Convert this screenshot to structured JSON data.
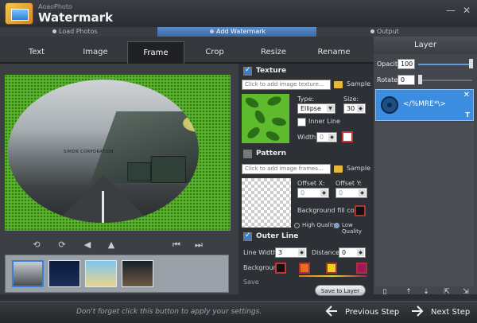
{
  "app": {
    "vendor": "AoaoPhoto",
    "product": "Watermark"
  },
  "steps": [
    {
      "label": "Load Photos",
      "active": false
    },
    {
      "label": "Add Watermark",
      "active": true
    },
    {
      "label": "Output",
      "active": false
    }
  ],
  "tabs": [
    {
      "label": "Text",
      "active": false
    },
    {
      "label": "Image",
      "active": false
    },
    {
      "label": "Frame",
      "active": true
    },
    {
      "label": "Crop",
      "active": false
    },
    {
      "label": "Resize",
      "active": false
    },
    {
      "label": "Rename",
      "active": false
    }
  ],
  "preview": {
    "watermark_text": "SIMDN CORPORATION"
  },
  "texture": {
    "label": "Texture",
    "checked": true,
    "input_placeholder": "Click to add image texture...",
    "sample_label": "Sample",
    "type_label": "Type:",
    "type_value": "Ellipse",
    "size_label": "Size:",
    "size_value": "30",
    "inner_line_label": "Inner Line",
    "width_label": "Width:",
    "width_value": "0"
  },
  "pattern": {
    "label": "Pattern",
    "checked": false,
    "input_placeholder": "Click to add image frames...",
    "sample_label": "Sample",
    "offset_x_label": "Offset X:",
    "offset_x_value": "0",
    "offset_y_label": "Offset Y:",
    "offset_y_value": "0",
    "bg_fill_label": "Background fill color:",
    "quality_high": "High Quality",
    "quality_low": "Low Quality",
    "quality_selected": "Low Quality"
  },
  "outer_line": {
    "label": "Outer Line",
    "checked": true,
    "line_width_label": "Line Width:",
    "line_width_value": "3",
    "distance_label": "Distance:",
    "distance_value": "0",
    "background_label": "Background"
  },
  "save_section_label": "Save",
  "save_button": "Save to Layer",
  "layer": {
    "title": "Layer",
    "opacity_label": "Opacity",
    "opacity_value": "100",
    "rotate_label": "Rotate",
    "rotate_value": "0",
    "item_text": "</%MRE*\\>",
    "item_type": "T"
  },
  "bottom": {
    "hint": "Don't forget click this button to apply your settings.",
    "previous": "Previous Step",
    "next": "Next Step"
  },
  "colors": {
    "accent": "#3c8de0",
    "frame_green": "#5fb52f",
    "panel": "#2d3034"
  }
}
